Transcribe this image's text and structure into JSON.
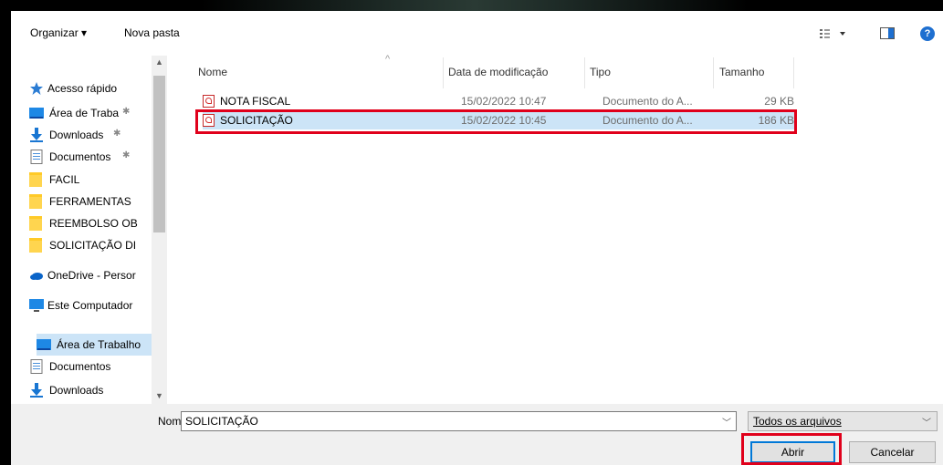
{
  "toolbar": {
    "organize_label": "Organizar ▾",
    "new_folder_label": "Nova pasta",
    "help_label": "?"
  },
  "nav": {
    "items": [
      {
        "label": "Acesso rápido",
        "icon": "star-icon",
        "pinned": false
      },
      {
        "label": "Área de Traba",
        "icon": "desktop-icon",
        "pinned": true
      },
      {
        "label": "Downloads",
        "icon": "download-icon",
        "pinned": true
      },
      {
        "label": "Documentos",
        "icon": "documents-icon",
        "pinned": true
      },
      {
        "label": "FACIL",
        "icon": "folder-icon",
        "pinned": false
      },
      {
        "label": "FERRAMENTAS",
        "icon": "folder-icon",
        "pinned": false
      },
      {
        "label": "REEMBOLSO OB",
        "icon": "folder-icon",
        "pinned": false
      },
      {
        "label": "SOLICITAÇÃO DI",
        "icon": "folder-icon",
        "pinned": false
      },
      {
        "label": "OneDrive - Persor",
        "icon": "onedrive-icon",
        "pinned": false
      },
      {
        "label": "Este Computador",
        "icon": "computer-icon",
        "pinned": false
      },
      {
        "label": "Área de Trabalho",
        "icon": "desktop-icon",
        "pinned": false,
        "selected": true
      },
      {
        "label": "Documentos",
        "icon": "documents-icon",
        "pinned": false
      },
      {
        "label": "Downloads",
        "icon": "download-icon",
        "pinned": false
      }
    ],
    "pin_glyph": "✱"
  },
  "columns": {
    "name": "Nome",
    "date": "Data de modificação",
    "type": "Tipo",
    "size": "Tamanho"
  },
  "files": [
    {
      "name": "NOTA FISCAL",
      "date": "15/02/2022 10:47",
      "type": "Documento do A...",
      "size": "29 KB",
      "icon": "pdf-icon"
    },
    {
      "name": "SOLICITAÇÃO",
      "date": "15/02/2022 10:45",
      "type": "Documento do A...",
      "size": "186 KB",
      "icon": "pdf-icon",
      "selected": true
    }
  ],
  "footer": {
    "name_label": "Nome:",
    "filename_value": "SOLICITAÇÃO",
    "filter_value": "Todos os arquivos",
    "open_label": "Abrir",
    "cancel_label": "Cancelar"
  },
  "colors": {
    "selection": "#cce4f7",
    "highlight_box": "#e0001b",
    "accent": "#0078d7"
  }
}
